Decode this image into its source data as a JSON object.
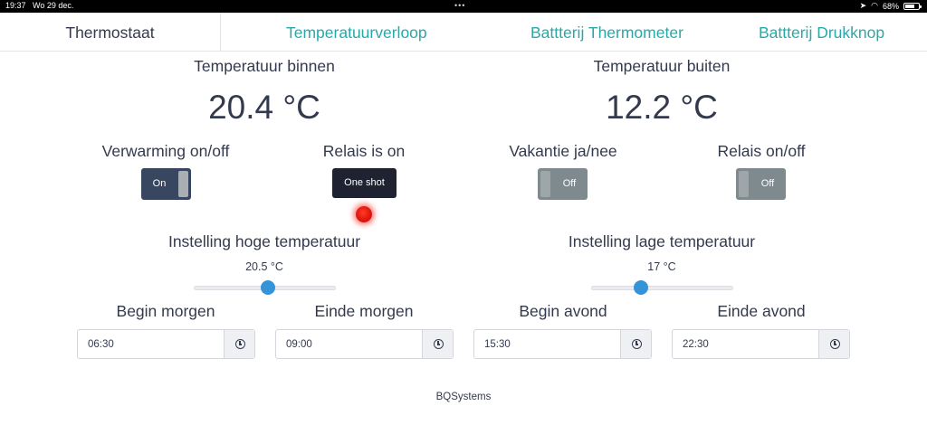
{
  "statusbar": {
    "time": "19:37",
    "date": "Wo 29 dec.",
    "battery": "68%",
    "battery_level": 0.68
  },
  "tabs": [
    {
      "label": "Thermostaat"
    },
    {
      "label": "Temperatuurverloop"
    },
    {
      "label": "Battterij Thermometer"
    },
    {
      "label": "Battterij Drukknop"
    }
  ],
  "indoor": {
    "label": "Temperatuur binnen",
    "value": "20.4 °C"
  },
  "outdoor": {
    "label": "Temperatuur buiten",
    "value": "12.2 °C"
  },
  "controls": {
    "heating": {
      "label": "Verwarming on/off",
      "state": "On"
    },
    "relay_status": {
      "label": "Relais is on",
      "button": "One shot",
      "led_color": "#e8190f"
    },
    "vacation": {
      "label": "Vakantie ja/nee",
      "state": "Off"
    },
    "relay": {
      "label": "Relais on/off",
      "state": "Off"
    }
  },
  "high_temp": {
    "label": "Instelling hoge temperatuur",
    "value_text": "20.5 °C",
    "slider_fraction": 0.52
  },
  "low_temp": {
    "label": "Instelling lage temperatuur",
    "value_text": "17 °C",
    "slider_fraction": 0.35
  },
  "times": {
    "begin_morning": {
      "label": "Begin morgen",
      "value": "06:30"
    },
    "end_morning": {
      "label": "Einde morgen",
      "value": "09:00"
    },
    "begin_evening": {
      "label": "Begin avond",
      "value": "15:30"
    },
    "end_evening": {
      "label": "Einde avond",
      "value": "22:30"
    }
  },
  "footer": {
    "text": "BQSystems"
  },
  "colors": {
    "accent": "#2aa8a8",
    "text": "#333a4d",
    "toggle_on": "#384660",
    "toggle_off": "#7e8a8e",
    "slider": "#3594d8"
  }
}
